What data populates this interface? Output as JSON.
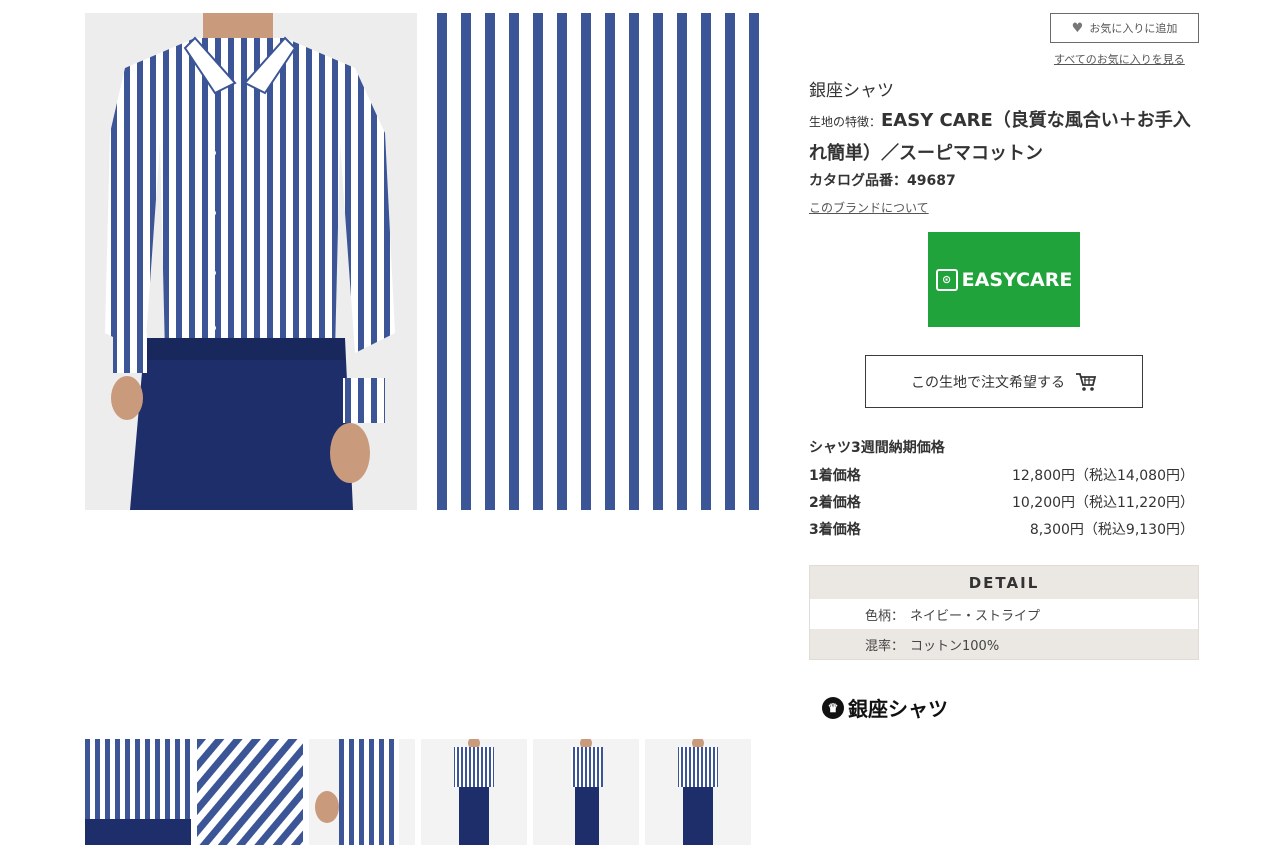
{
  "favorite": {
    "add_label": "お気に入りに追加",
    "view_all_label": "すべてのお気に入りを見る"
  },
  "product": {
    "brand_title": "銀座シャツ",
    "feature_label": "生地の特徴：",
    "feature_text": "EASY CARE（良質な風合い＋お手入れ簡単）／スーピマコットン",
    "catalog": "カタログ品番：49687",
    "brand_link": "このブランドについて",
    "badge_text": "EASYCARE",
    "order_button": "この生地で注文希望する"
  },
  "pricing": {
    "title": "シャツ3週間納期価格",
    "rows": [
      {
        "qty": "1着価格",
        "price": "12,800円（税込14,080円）"
      },
      {
        "qty": "2着価格",
        "price": "10,200円（税込11,220円）"
      },
      {
        "qty": "3着価格",
        "price": "8,300円（税込9,130円）"
      }
    ]
  },
  "detail": {
    "heading": "DETAIL",
    "rows": [
      {
        "key": "色柄：",
        "value": "ネイビー・ストライプ"
      },
      {
        "key": "混率：",
        "value": "コットン100%"
      }
    ]
  },
  "footer": {
    "logo_text": "銀座シャツ"
  },
  "colors": {
    "stripe_navy": "#3b5596",
    "badge_green": "#21a33c",
    "detail_bg": "#ebe7e2"
  },
  "icons": [
    "heart-icon",
    "cart-icon",
    "easycare-icon",
    "logo-mark-icon"
  ]
}
